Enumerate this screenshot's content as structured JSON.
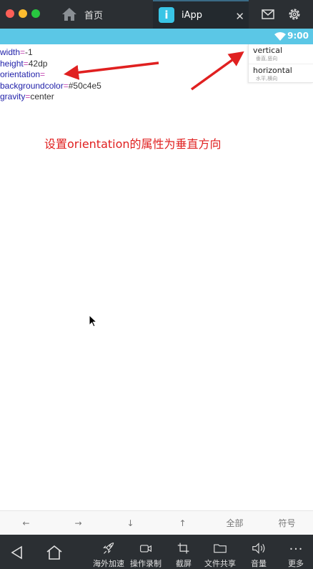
{
  "window": {
    "tabs": [
      {
        "label": "首页"
      },
      {
        "label": "iApp"
      }
    ],
    "app_icon_letter": "i"
  },
  "statusbar": {
    "time": "9:00"
  },
  "editor": {
    "lines": [
      {
        "key": "width",
        "eq": "=",
        "value": "-1"
      },
      {
        "key": "height",
        "eq": "=",
        "value": "42dp"
      },
      {
        "key": "orientation",
        "eq": "=",
        "value": ""
      },
      {
        "key": "backgroundcolor",
        "eq": "=",
        "value": "#50c4e5"
      },
      {
        "key": "gravity",
        "eq": "=",
        "value": "center"
      }
    ]
  },
  "suggestions": [
    {
      "title": "vertical",
      "sub": "垂直,竖向"
    },
    {
      "title": "horizontal",
      "sub": "水平,横向"
    }
  ],
  "annotation": "设置orientation的属性为垂直方向",
  "keyrow": [
    "←",
    "→",
    "↓",
    "↑",
    "全部",
    "符号"
  ],
  "bottombar": {
    "items": [
      {
        "label": "海外加速"
      },
      {
        "label": "操作录制"
      },
      {
        "label": "截屏"
      },
      {
        "label": "文件共享"
      },
      {
        "label": "音量"
      },
      {
        "label": "更多"
      }
    ]
  },
  "colors": {
    "accent": "#5bc7e6",
    "arrow": "#e02020",
    "titlebar": "#2b2f33"
  }
}
